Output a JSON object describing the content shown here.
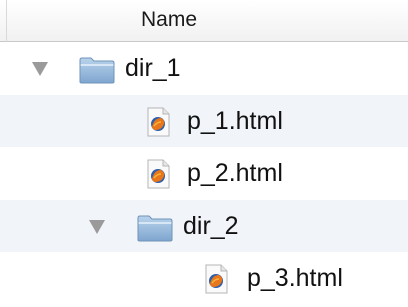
{
  "header": {
    "name_column": "Name"
  },
  "tree": {
    "items": [
      {
        "label": "dir_1",
        "type": "folder",
        "depth": 0,
        "expanded": true
      },
      {
        "label": "p_1.html",
        "type": "file",
        "depth": 1
      },
      {
        "label": "p_2.html",
        "type": "file",
        "depth": 1
      },
      {
        "label": "dir_2",
        "type": "folder",
        "depth": 1,
        "expanded": true
      },
      {
        "label": "p_3.html",
        "type": "file",
        "depth": 2
      }
    ]
  },
  "colors": {
    "row_alt": "#f1f4f9",
    "folder_blue": "#8fb4d9",
    "disclosure_gray": "#9a9a9a"
  }
}
